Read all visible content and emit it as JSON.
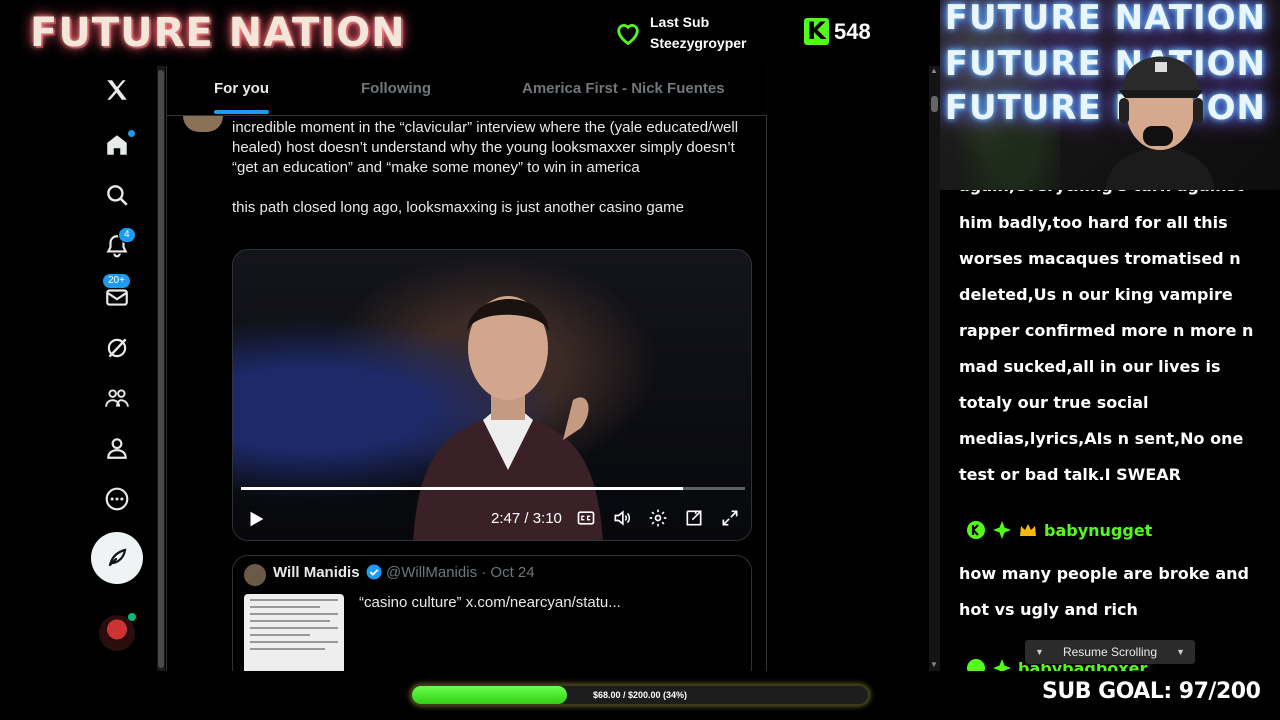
{
  "stream": {
    "brand": "FUTURE NATION",
    "last_sub_label": "Last Sub",
    "last_sub_name": "Steezygroyper",
    "kick_logo": "K",
    "follower_count": "548",
    "accent_green": "#53fc18"
  },
  "xnav": {
    "items": [
      {
        "icon": "x-logo-icon"
      },
      {
        "icon": "home-icon"
      },
      {
        "icon": "search-icon"
      },
      {
        "icon": "notifications-icon",
        "badge": "4"
      },
      {
        "icon": "messages-icon",
        "badge": "20+"
      },
      {
        "icon": "grok-icon"
      },
      {
        "icon": "communities-icon"
      },
      {
        "icon": "profile-icon"
      },
      {
        "icon": "more-icon"
      }
    ],
    "post_icon": "compose-icon"
  },
  "feed": {
    "tabs": [
      "For you",
      "Following",
      "America First - Nick Fuentes"
    ],
    "active_tab": 0,
    "tweet": {
      "paragraph1": "incredible moment in the “clavicular” interview where the (yale educated/well healed) host doesn’t understand why the young looksmaxxer simply doesn’t “get an education” and “make some money” to win in america",
      "paragraph2": "this path closed long ago, looksmaxxing is just another casino game"
    },
    "video": {
      "time": "2:47 / 3:10",
      "progress_fraction": 0.876
    },
    "quote": {
      "name": "Will Manidis",
      "handle_date": "@WillManidis · Oct 24",
      "text": "“casino culture”  x.com/nearcyan/statu..."
    }
  },
  "webcam": {
    "neon_lines": [
      "FUTURE NATION",
      "FUTURE NATION",
      "FUTURE NATION"
    ]
  },
  "chat": {
    "partial_line": "again,everything's turn against",
    "message1_lines": [
      "him badly,too hard for all this",
      "worses macaques tromatised n",
      "deleted,Us n our king vampire",
      "rapper confirmed more n more n",
      "mad sucked,all in our lives is",
      "totaly our true social",
      "medias,lyrics,AIs n sent,No one",
      "test or bad talk.I SWEAR"
    ],
    "user2": "babynugget",
    "message2_lines": [
      "how many people are broke and",
      "hot vs ugly and rich"
    ],
    "next_user_partial": "babybagboxer",
    "resume_label": "Resume Scrolling"
  },
  "goal": {
    "bar_text": "$68.00 / $200.00 (34%)",
    "fraction": 0.34,
    "sub_goal": "SUB GOAL: 97/200"
  }
}
